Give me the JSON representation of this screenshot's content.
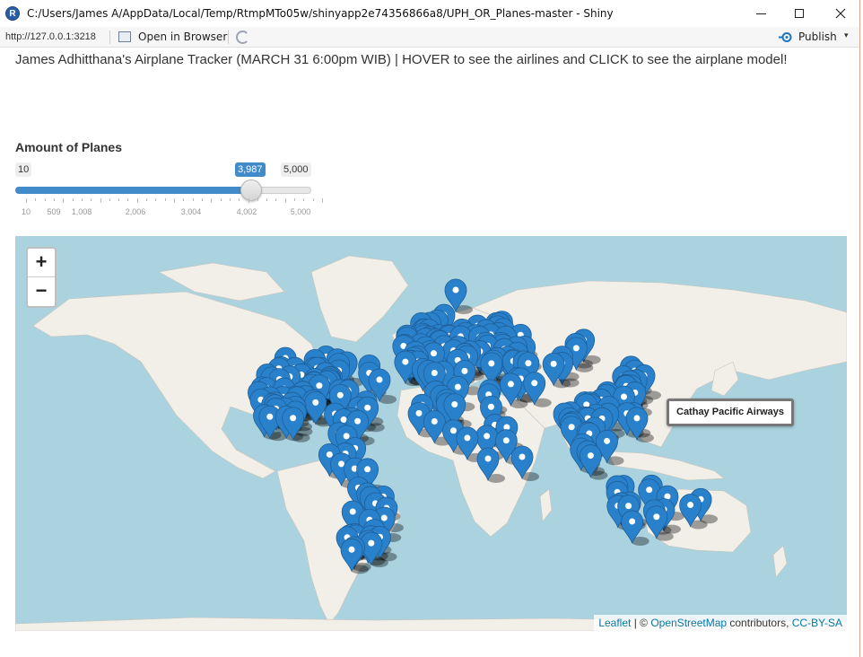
{
  "window": {
    "title": "C:/Users/James A/AppData/Local/Temp/RtmpMTo05w/shinyapp2e74356866a8/UPH_OR_Planes-master - Shiny",
    "app_icon_letter": "R",
    "minimize_icon": "minimize-icon",
    "maximize_icon": "maximize-icon",
    "close_icon": "close-icon"
  },
  "toolbar": {
    "url": "http://127.0.0.1:3218",
    "open_in_browser": "Open in Browser",
    "publish": "Publish",
    "publish_caret": "▾",
    "publish_color": "#1a75bc"
  },
  "app": {
    "headline": "James Adhitthana's Airplane Tracker (MARCH 31 6:00pm WIB) | HOVER to see the airlines and CLICK to see the airplane model!",
    "slider": {
      "label": "Amount of Planes",
      "min": 10,
      "max": 5000,
      "value": 3987,
      "min_label": "10",
      "max_label": "5,000",
      "value_label": "3,987",
      "tick_labels": [
        "10",
        "509",
        "1,008",
        "2,006",
        "3,004",
        "4,002",
        "5,000"
      ],
      "accent": "#428bca"
    },
    "map": {
      "zoom_in": "+",
      "zoom_out": "−",
      "tooltip": "Cathay Pacific Airways",
      "marker_color": "#2a81cb",
      "attribution": {
        "leaflet": "Leaflet",
        "sep": " | © ",
        "osm": "OpenStreetMap",
        "contributors": " contributors, ",
        "license": "CC-BY-SA"
      }
    }
  }
}
